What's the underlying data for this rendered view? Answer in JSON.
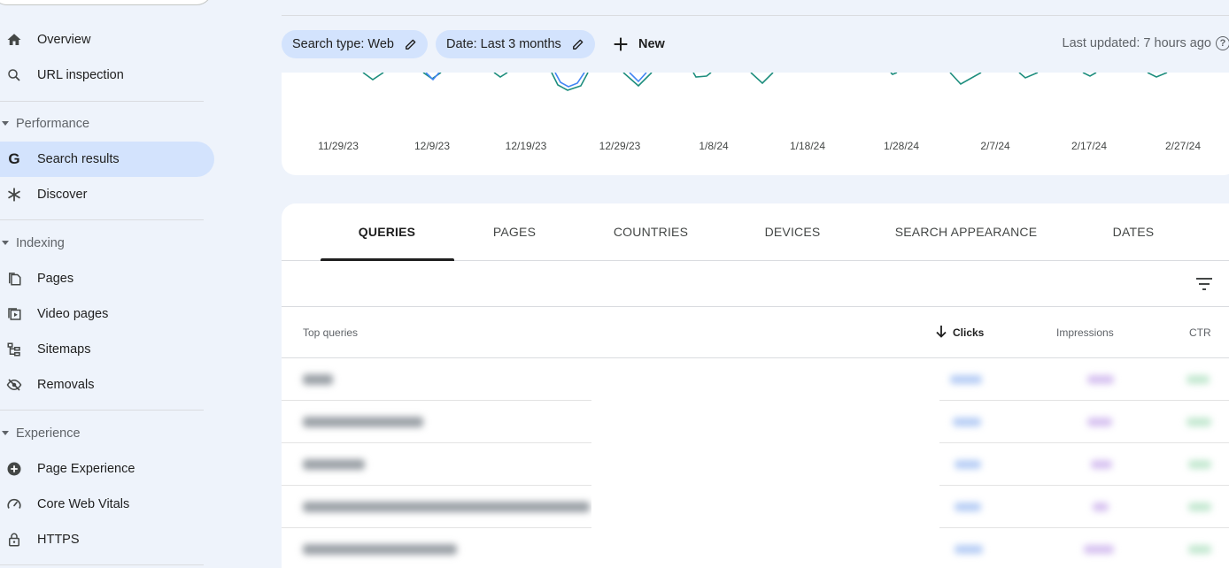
{
  "sidebar": {
    "overview": "Overview",
    "url_inspection": "URL inspection",
    "performance_section": "Performance",
    "search_results": "Search results",
    "discover": "Discover",
    "indexing_section": "Indexing",
    "pages": "Pages",
    "video_pages": "Video pages",
    "sitemaps": "Sitemaps",
    "removals": "Removals",
    "experience_section": "Experience",
    "page_experience": "Page Experience",
    "core_web_vitals": "Core Web Vitals",
    "https": "HTTPS"
  },
  "filters": {
    "search_type": "Search type: Web",
    "date": "Date: Last 3 months",
    "new": "New",
    "last_updated": "Last updated: 7 hours ago"
  },
  "chart_data": {
    "type": "line",
    "x_tick_labels": [
      "11/29/23",
      "12/9/23",
      "12/19/23",
      "12/29/23",
      "1/8/24",
      "1/18/24",
      "1/28/24",
      "2/7/24",
      "2/17/24",
      "2/27/24"
    ],
    "series_colors": [
      "#1e8e7e",
      "#4285f4"
    ]
  },
  "tabs": [
    "QUERIES",
    "PAGES",
    "COUNTRIES",
    "DEVICES",
    "SEARCH APPEARANCE",
    "DATES"
  ],
  "table": {
    "columns": {
      "query": "Top queries",
      "clicks": "Clicks",
      "impressions": "Impressions",
      "ctr": "CTR"
    },
    "sort_column": "Clicks",
    "sort_direction": "descending"
  }
}
